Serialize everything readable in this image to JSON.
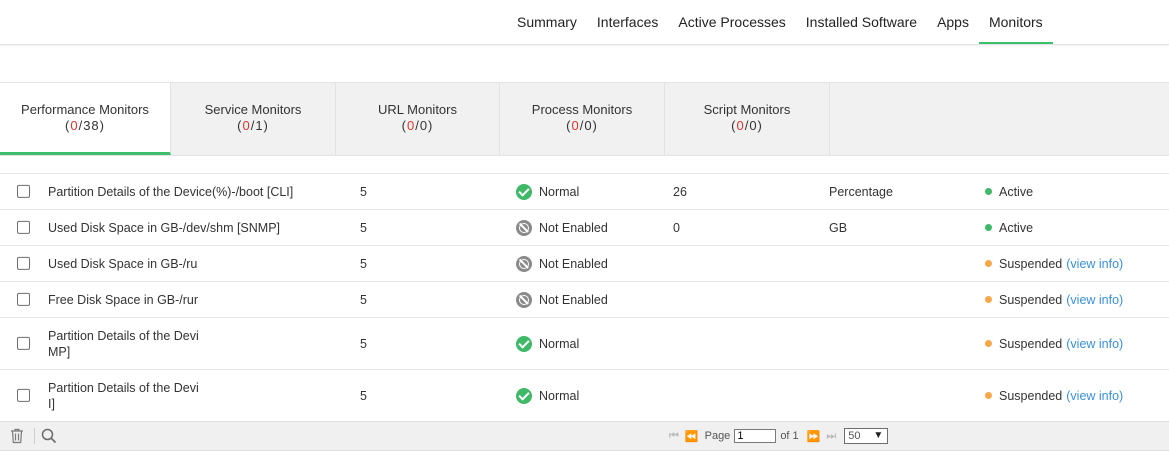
{
  "topnav": {
    "items": [
      {
        "label": "Summary"
      },
      {
        "label": "Interfaces"
      },
      {
        "label": "Active Processes"
      },
      {
        "label": "Installed Software"
      },
      {
        "label": "Apps"
      },
      {
        "label": "Monitors"
      }
    ],
    "active": "Monitors"
  },
  "monitor_tabs": [
    {
      "label": "Performance Monitors",
      "count_red": "0",
      "count_total": "38"
    },
    {
      "label": "Service Monitors",
      "count_red": "0",
      "count_total": "1"
    },
    {
      "label": "URL Monitors",
      "count_red": "0",
      "count_total": "0"
    },
    {
      "label": "Process Monitors",
      "count_red": "0",
      "count_total": "0"
    },
    {
      "label": "Script Monitors",
      "count_red": "0",
      "count_total": "0"
    }
  ],
  "rows": [
    {
      "name": "Partition Details of the Device(%)-/boot [CLI]",
      "poll": "5",
      "status": "Normal",
      "value": "26",
      "unit": "Percentage",
      "state": "Active",
      "view_info": ""
    },
    {
      "name": "Used Disk Space in GB-/dev/shm [SNMP]",
      "poll": "5",
      "status": "Not Enabled",
      "value": "0",
      "unit": "GB",
      "state": "Active",
      "view_info": ""
    },
    {
      "name": "Used Disk Space in GB-/run/",
      "poll": "5",
      "status": "Not Enabled",
      "value": "",
      "unit": "",
      "state": "Suspended",
      "view_info": "(view info)"
    },
    {
      "name": "Free Disk Space in GB-/run/",
      "poll": "5",
      "status": "Not Enabled",
      "value": "",
      "unit": "",
      "state": "Suspended",
      "view_info": "(view info)"
    },
    {
      "name": "Partition Details of the Devi\nMP]",
      "poll": "5",
      "status": "Normal",
      "value": "",
      "unit": "",
      "state": "Suspended",
      "view_info": "(view info)"
    },
    {
      "name": "Partition Details of the Devic\nI]",
      "poll": "5",
      "status": "Normal",
      "value": "",
      "unit": "",
      "state": "Suspended",
      "view_info": "(view info)"
    }
  ],
  "footer": {
    "page_label": "Page",
    "page_value": "1",
    "of_label": "of 1",
    "per_page": "50"
  },
  "colors": {
    "accent": "#3dbf6e",
    "count_red": "#e0352f",
    "active_dot": "#3fb868",
    "suspended_dot": "#f3a84a",
    "link": "#3b8fd8"
  }
}
